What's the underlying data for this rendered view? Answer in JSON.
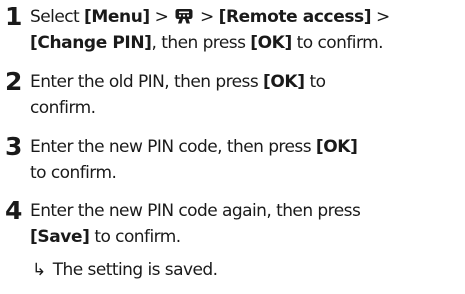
{
  "steps": [
    {
      "number": "1",
      "line1": {
        "t1": "Select ",
        "b1": "[Menu]",
        "t2": " > ",
        "icon": "phone-settings-icon",
        "t3": " > ",
        "b2": "[Remote access]",
        "t4": " >"
      },
      "line2": {
        "b1": "[Change PIN]",
        "t1": ", then press ",
        "b2": "[OK]",
        "t2": " to confirm."
      }
    },
    {
      "number": "2",
      "line1": {
        "t1": "Enter the old PIN, then press ",
        "b1": "[OK]",
        "t2": " to"
      },
      "line2": {
        "t1": "confirm."
      }
    },
    {
      "number": "3",
      "line1": {
        "t1": "Enter the new PIN code, then press ",
        "b1": "[OK]"
      },
      "line2": {
        "t1": "to confirm."
      }
    },
    {
      "number": "4",
      "line1": {
        "t1": "Enter the new PIN code again, then press"
      },
      "line2": {
        "b1": "[Save]",
        "t1": " to confirm."
      }
    }
  ],
  "result": {
    "arrow": "↳",
    "text": "The setting is saved."
  },
  "colors": {
    "text": "#1a1a1a",
    "background": "#ffffff"
  }
}
